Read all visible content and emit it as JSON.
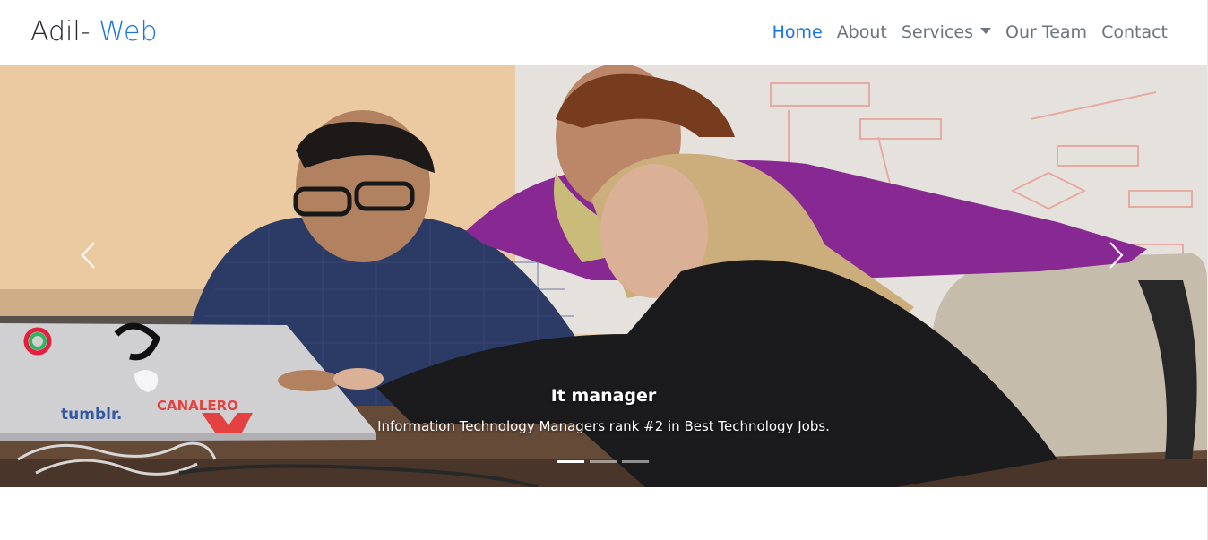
{
  "brand": {
    "name": "Adil-",
    "accent": "Web"
  },
  "nav": {
    "home": "Home",
    "about": "About",
    "services": "Services",
    "team": "Our Team",
    "contact": "Contact"
  },
  "carousel": {
    "slide_title": "It manager",
    "slide_text": "Information Technology Managers rank #2 in Best Technology Jobs.",
    "slide_count": 3,
    "active_slide": 1,
    "photo_alt": "Three people working together at a laptop",
    "laptop_stickers": [
      "tumblr.",
      "CANALERO"
    ]
  },
  "colors": {
    "accent": "#1a73e8",
    "nav_text": "#6c757d",
    "brand_text": "#212529"
  }
}
